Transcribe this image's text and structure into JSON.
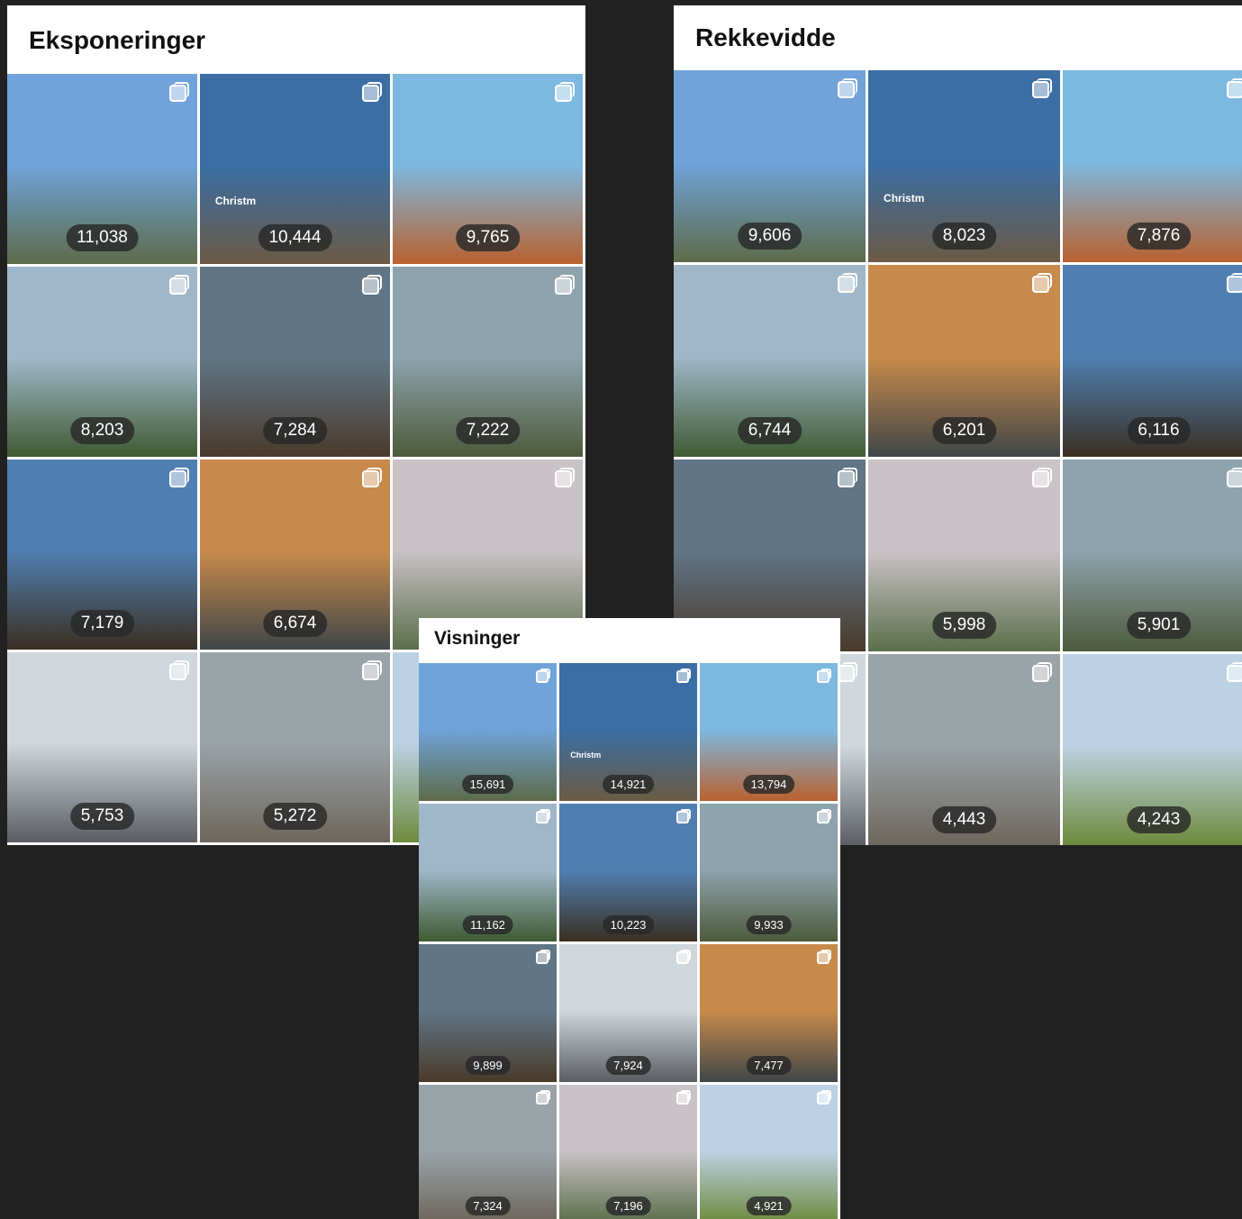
{
  "panels": {
    "eksponeringer": {
      "title": "Eksponeringer",
      "posts": [
        {
          "value": "11,038",
          "scene": "gausta",
          "overlay": ""
        },
        {
          "value": "10,444",
          "scene": "christmas",
          "overlay": "Christm"
        },
        {
          "value": "9,765",
          "scene": "mountain-lake",
          "overlay": ""
        },
        {
          "value": "8,203",
          "scene": "two-women",
          "overlay": ""
        },
        {
          "value": "7,284",
          "scene": "stave-church",
          "overlay": ""
        },
        {
          "value": "7,222",
          "scene": "waterfall",
          "overlay": ""
        },
        {
          "value": "7,179",
          "scene": "hotel",
          "overlay": ""
        },
        {
          "value": "6,674",
          "scene": "fjord-sunset",
          "overlay": ""
        },
        {
          "value": "",
          "scene": "marble",
          "overlay": ""
        },
        {
          "value": "5,753",
          "scene": "spa",
          "overlay": ""
        },
        {
          "value": "5,272",
          "scene": "storehouse",
          "overlay": ""
        },
        {
          "value": "",
          "scene": "lake-tree",
          "overlay": ""
        }
      ]
    },
    "rekkevidde": {
      "title": "Rekkevidde",
      "posts": [
        {
          "value": "9,606",
          "scene": "gausta",
          "overlay": ""
        },
        {
          "value": "8,023",
          "scene": "christmas",
          "overlay": "Christm"
        },
        {
          "value": "7,876",
          "scene": "mountain-lake",
          "overlay": ""
        },
        {
          "value": "6,744",
          "scene": "two-women",
          "overlay": ""
        },
        {
          "value": "6,201",
          "scene": "fjord-sunset",
          "overlay": ""
        },
        {
          "value": "6,116",
          "scene": "hotel",
          "overlay": ""
        },
        {
          "value": "",
          "scene": "stave-church",
          "overlay": ""
        },
        {
          "value": "5,998",
          "scene": "marble",
          "overlay": ""
        },
        {
          "value": "5,901",
          "scene": "waterfall",
          "overlay": ""
        },
        {
          "value": "",
          "scene": "spa",
          "overlay": ""
        },
        {
          "value": "4,443",
          "scene": "storehouse",
          "overlay": ""
        },
        {
          "value": "4,243",
          "scene": "lake-tree",
          "overlay": ""
        }
      ]
    },
    "visninger": {
      "title": "Visninger",
      "posts": [
        {
          "value": "15,691",
          "scene": "gausta",
          "overlay": ""
        },
        {
          "value": "14,921",
          "scene": "christmas",
          "overlay": "Christm"
        },
        {
          "value": "13,794",
          "scene": "mountain-lake",
          "overlay": ""
        },
        {
          "value": "11,162",
          "scene": "two-women",
          "overlay": ""
        },
        {
          "value": "10,223",
          "scene": "hotel",
          "overlay": ""
        },
        {
          "value": "9,933",
          "scene": "waterfall",
          "overlay": ""
        },
        {
          "value": "9,899",
          "scene": "stave-church",
          "overlay": ""
        },
        {
          "value": "7,924",
          "scene": "spa",
          "overlay": ""
        },
        {
          "value": "7,477",
          "scene": "fjord-sunset",
          "overlay": ""
        },
        {
          "value": "7,324",
          "scene": "storehouse",
          "overlay": ""
        },
        {
          "value": "7,196",
          "scene": "marble",
          "overlay": ""
        },
        {
          "value": "4,921",
          "scene": "lake-tree",
          "overlay": ""
        }
      ]
    }
  },
  "scene_colors": {
    "gausta": {
      "sky": "#6fa3d9",
      "land": "#5d6b4a"
    },
    "christmas": {
      "sky": "#3a6ea5",
      "land": "#6b5a44"
    },
    "mountain-lake": {
      "sky": "#7db8e0",
      "land": "#b9612f"
    },
    "two-women": {
      "sky": "#9fb7c9",
      "land": "#3e5b32"
    },
    "stave-church": {
      "sky": "#607585",
      "land": "#4a3a2a"
    },
    "waterfall": {
      "sky": "#8da3ad",
      "land": "#4d5a3a"
    },
    "hotel": {
      "sky": "#4f7fb0",
      "land": "#3b2f22"
    },
    "fjord-sunset": {
      "sky": "#c88a4a",
      "land": "#3f4648"
    },
    "marble": {
      "sky": "#c9c2c6",
      "land": "#5b6e4a"
    },
    "spa": {
      "sky": "#cfd6dc",
      "land": "#5a5e63"
    },
    "storehouse": {
      "sky": "#9aa3a8",
      "land": "#6d665c"
    },
    "lake-tree": {
      "sky": "#bcd2e4",
      "land": "#6d8a3c"
    }
  }
}
